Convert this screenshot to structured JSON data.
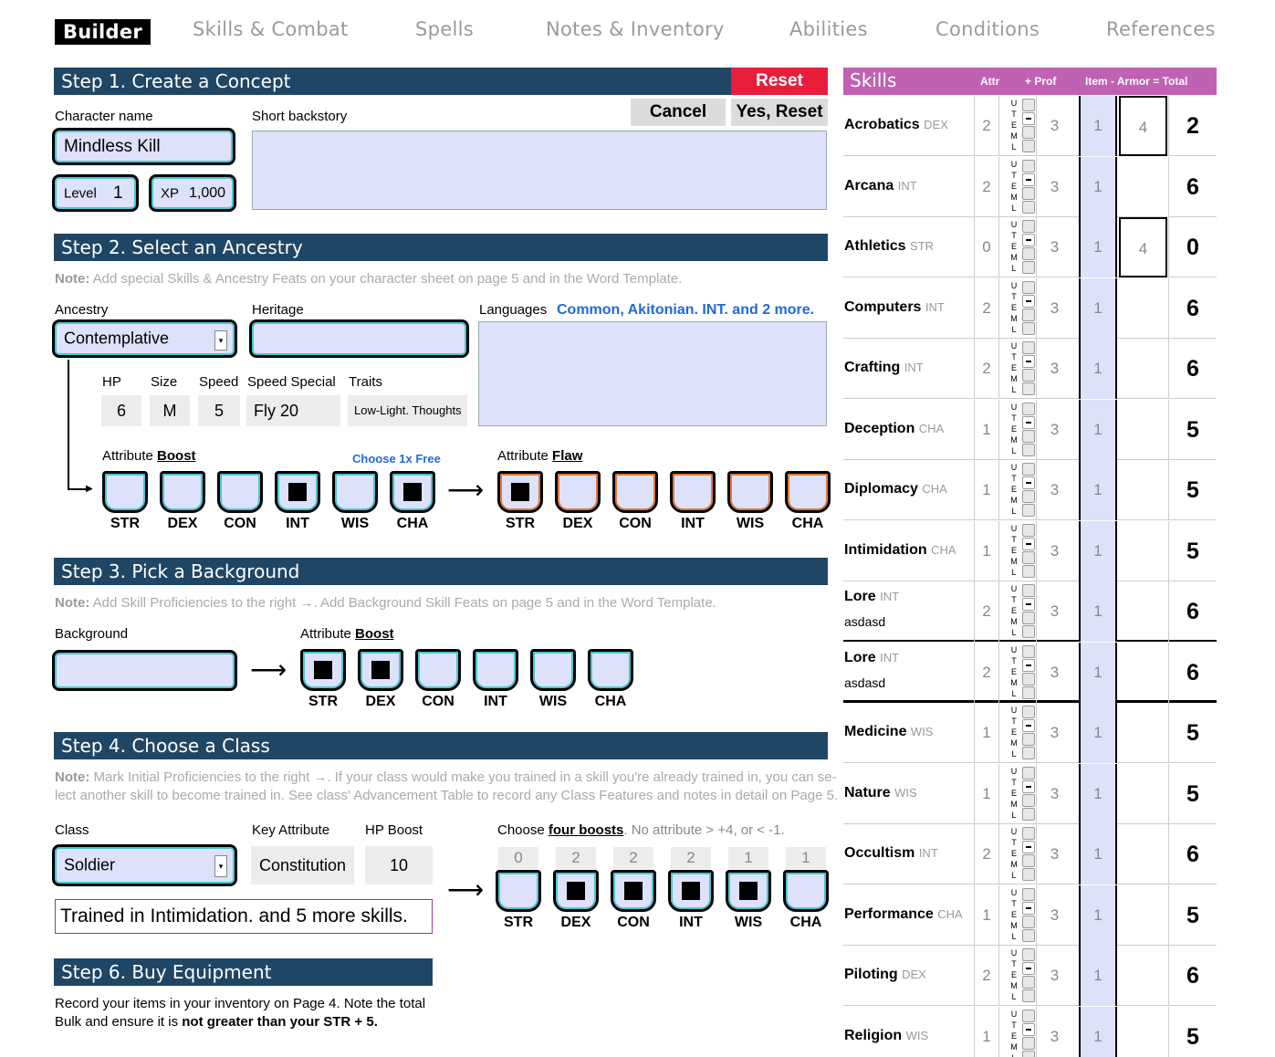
{
  "nav": [
    "Builder",
    "Skills & Combat",
    "Spells",
    "Notes & Inventory",
    "Abilities",
    "Conditions",
    "References"
  ],
  "step1": {
    "title": "Step 1. Create a Concept",
    "reset": "Reset",
    "cancel": "Cancel",
    "yes_reset": "Yes, Reset",
    "char_name_label": "Character name",
    "char_name": "Mindless Kill",
    "backstory_label": "Short backstory",
    "backstory": "",
    "level_label": "Level",
    "level": "1",
    "xp_label": "XP",
    "xp": "1,000"
  },
  "step2": {
    "title": "Step 2. Select an Ancestry",
    "note_bold": "Note:",
    "note": " Add special Skills & Ancestry Feats on your character sheet on page 5 and in the Word Template.",
    "ancestry_label": "Ancestry",
    "ancestry": "Contemplative",
    "heritage_label": "Heritage",
    "heritage": "",
    "languages_label": "Languages",
    "languages": "Common, Akitonian. INT. and 2 more.",
    "hp_label": "HP",
    "hp": "6",
    "size_label": "Size",
    "size": "M",
    "speed_label": "Speed",
    "speed": "5",
    "speed_special_label": "Speed Special",
    "speed_special": "Fly 20",
    "traits_label": "Traits",
    "traits": "Low-Light. Thoughts",
    "boost_label_a": "Attribute ",
    "boost_label_b": "Boost",
    "choose_free": "Choose 1x Free",
    "flaw_label_a": "Attribute ",
    "flaw_label_b": "Flaw",
    "arrow": "⟶"
  },
  "attrs": [
    "STR",
    "DEX",
    "CON",
    "INT",
    "WIS",
    "CHA"
  ],
  "ancestry_boosts": [
    false,
    false,
    false,
    true,
    false,
    true
  ],
  "ancestry_flaws": [
    true,
    false,
    false,
    false,
    false,
    false
  ],
  "step3": {
    "title": "Step 3. Pick a Background",
    "note_bold": "Note:",
    "note": " Add Skill Proficiencies to the right →. Add Background Skill Feats on page 5 and in the Word Template.",
    "background_label": "Background",
    "background": "",
    "boost_label_a": "Attribute ",
    "boost_label_b": "Boost"
  },
  "background_boosts": [
    true,
    true,
    false,
    false,
    false,
    false
  ],
  "step4": {
    "title": "Step 4. Choose a Class",
    "note_bold": "Note:",
    "note_line1": " Mark Initial Proficiencies to the right →. If your class would make you trained in a skill you're already trained in, you can se-",
    "note_line2": "lect another skill to become trained in. See class' Advancement Table to record any Class Features and notes in detail on Page 5.",
    "class_label": "Class",
    "class": "Soldier",
    "key_attr_label": "Key Attribute",
    "key_attr": "Constitution",
    "hp_boost_label": "HP Boost",
    "hp_boost": "10",
    "choose_a": "Choose ",
    "choose_b": "four boosts",
    "choose_c": ". No attribute > +4, or < -1.",
    "trained": "Trained in Intimidation. and 5 more skills."
  },
  "class_scores": [
    "0",
    "2",
    "2",
    "2",
    "1",
    "1"
  ],
  "class_boosts": [
    false,
    true,
    true,
    true,
    true,
    false
  ],
  "step6": {
    "title": "Step 6. Buy Equipment",
    "line1": "Record your items in your inventory on Page 4. Note the total",
    "line2a": "Bulk and ensure it is ",
    "line2b": "not greater than your STR + 5."
  },
  "skills_header": {
    "title": "Skills",
    "attr": "Attr",
    "prof": "+ Prof",
    "item": "Item - Armor = Total"
  },
  "prof_letters": [
    "U",
    "T",
    "E",
    "M",
    "L"
  ],
  "skills": [
    {
      "name": "Acrobatics",
      "attr_name": "DEX",
      "attr": "2",
      "prof": "3",
      "item": "1",
      "armor": "4",
      "total": "2",
      "sub": ""
    },
    {
      "name": "Arcana",
      "attr_name": "INT",
      "attr": "2",
      "prof": "3",
      "item": "1",
      "armor": "",
      "total": "6",
      "sub": ""
    },
    {
      "name": "Athletics",
      "attr_name": "STR",
      "attr": "0",
      "prof": "3",
      "item": "1",
      "armor": "4",
      "total": "0",
      "sub": ""
    },
    {
      "name": "Computers",
      "attr_name": "INT",
      "attr": "2",
      "prof": "3",
      "item": "1",
      "armor": "",
      "total": "6",
      "sub": ""
    },
    {
      "name": "Crafting",
      "attr_name": "INT",
      "attr": "2",
      "prof": "3",
      "item": "1",
      "armor": "",
      "total": "6",
      "sub": ""
    },
    {
      "name": "Deception",
      "attr_name": "CHA",
      "attr": "1",
      "prof": "3",
      "item": "1",
      "armor": "",
      "total": "5",
      "sub": ""
    },
    {
      "name": "Diplomacy",
      "attr_name": "CHA",
      "attr": "1",
      "prof": "3",
      "item": "1",
      "armor": "",
      "total": "5",
      "sub": ""
    },
    {
      "name": "Intimidation",
      "attr_name": "CHA",
      "attr": "1",
      "prof": "3",
      "item": "1",
      "armor": "",
      "total": "5",
      "sub": ""
    },
    {
      "name": "Lore",
      "attr_name": "INT",
      "attr": "2",
      "prof": "3",
      "item": "1",
      "armor": "",
      "total": "6",
      "sub": "asdasd"
    },
    {
      "name": "Lore",
      "attr_name": "INT",
      "attr": "2",
      "prof": "3",
      "item": "1",
      "armor": "",
      "total": "6",
      "sub": "asdasd"
    },
    {
      "name": "Medicine",
      "attr_name": "WIS",
      "attr": "1",
      "prof": "3",
      "item": "1",
      "armor": "",
      "total": "5",
      "sub": ""
    },
    {
      "name": "Nature",
      "attr_name": "WIS",
      "attr": "1",
      "prof": "3",
      "item": "1",
      "armor": "",
      "total": "5",
      "sub": ""
    },
    {
      "name": "Occultism",
      "attr_name": "INT",
      "attr": "2",
      "prof": "3",
      "item": "1",
      "armor": "",
      "total": "6",
      "sub": ""
    },
    {
      "name": "Performance",
      "attr_name": "CHA",
      "attr": "1",
      "prof": "3",
      "item": "1",
      "armor": "",
      "total": "5",
      "sub": ""
    },
    {
      "name": "Piloting",
      "attr_name": "DEX",
      "attr": "2",
      "prof": "3",
      "item": "1",
      "armor": "",
      "total": "6",
      "sub": ""
    },
    {
      "name": "Religion",
      "attr_name": "WIS",
      "attr": "1",
      "prof": "3",
      "item": "1",
      "armor": "",
      "total": "5",
      "sub": ""
    }
  ]
}
